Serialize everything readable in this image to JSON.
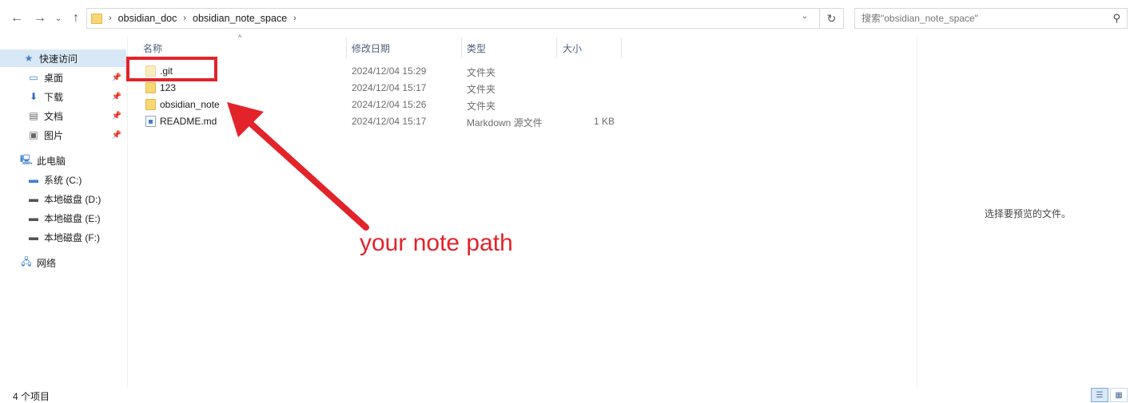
{
  "address_bar": {
    "breadcrumbs": [
      "obsidian_doc",
      "obsidian_note_space"
    ]
  },
  "search": {
    "placeholder": "搜索\"obsidian_note_space\""
  },
  "sidebar": {
    "quick_access": "快速访问",
    "pinned": [
      {
        "label": "桌面",
        "icon": "desktop-icon"
      },
      {
        "label": "下载",
        "icon": "download-icon"
      },
      {
        "label": "文档",
        "icon": "document-icon"
      },
      {
        "label": "图片",
        "icon": "pictures-icon"
      }
    ],
    "this_pc": "此电脑",
    "drives": [
      {
        "label": "系统 (C:)",
        "icon": "system-drive-icon"
      },
      {
        "label": "本地磁盘 (D:)",
        "icon": "drive-icon"
      },
      {
        "label": "本地磁盘 (E:)",
        "icon": "drive-icon"
      },
      {
        "label": "本地磁盘 (F:)",
        "icon": "drive-icon"
      }
    ],
    "network": "网络"
  },
  "columns": {
    "name": "名称",
    "date": "修改日期",
    "type": "类型",
    "size": "大小"
  },
  "files": [
    {
      "name": ".git",
      "date": "2024/12/04 15:29",
      "type": "文件夹",
      "size": "",
      "icon": "folder-icon"
    },
    {
      "name": "123",
      "date": "2024/12/04 15:17",
      "type": "文件夹",
      "size": "",
      "icon": "folder-icon"
    },
    {
      "name": "obsidian_note",
      "date": "2024/12/04 15:26",
      "type": "文件夹",
      "size": "",
      "icon": "folder-icon"
    },
    {
      "name": "README.md",
      "date": "2024/12/04 15:17",
      "type": "Markdown 源文件",
      "size": "1 KB",
      "icon": "markdown-file-icon"
    }
  ],
  "annotation": {
    "text": "your note path",
    "color": "#e3232a"
  },
  "preview": {
    "text": "选择要预览的文件。"
  },
  "status_bar": {
    "item_count": "4 个项目"
  }
}
